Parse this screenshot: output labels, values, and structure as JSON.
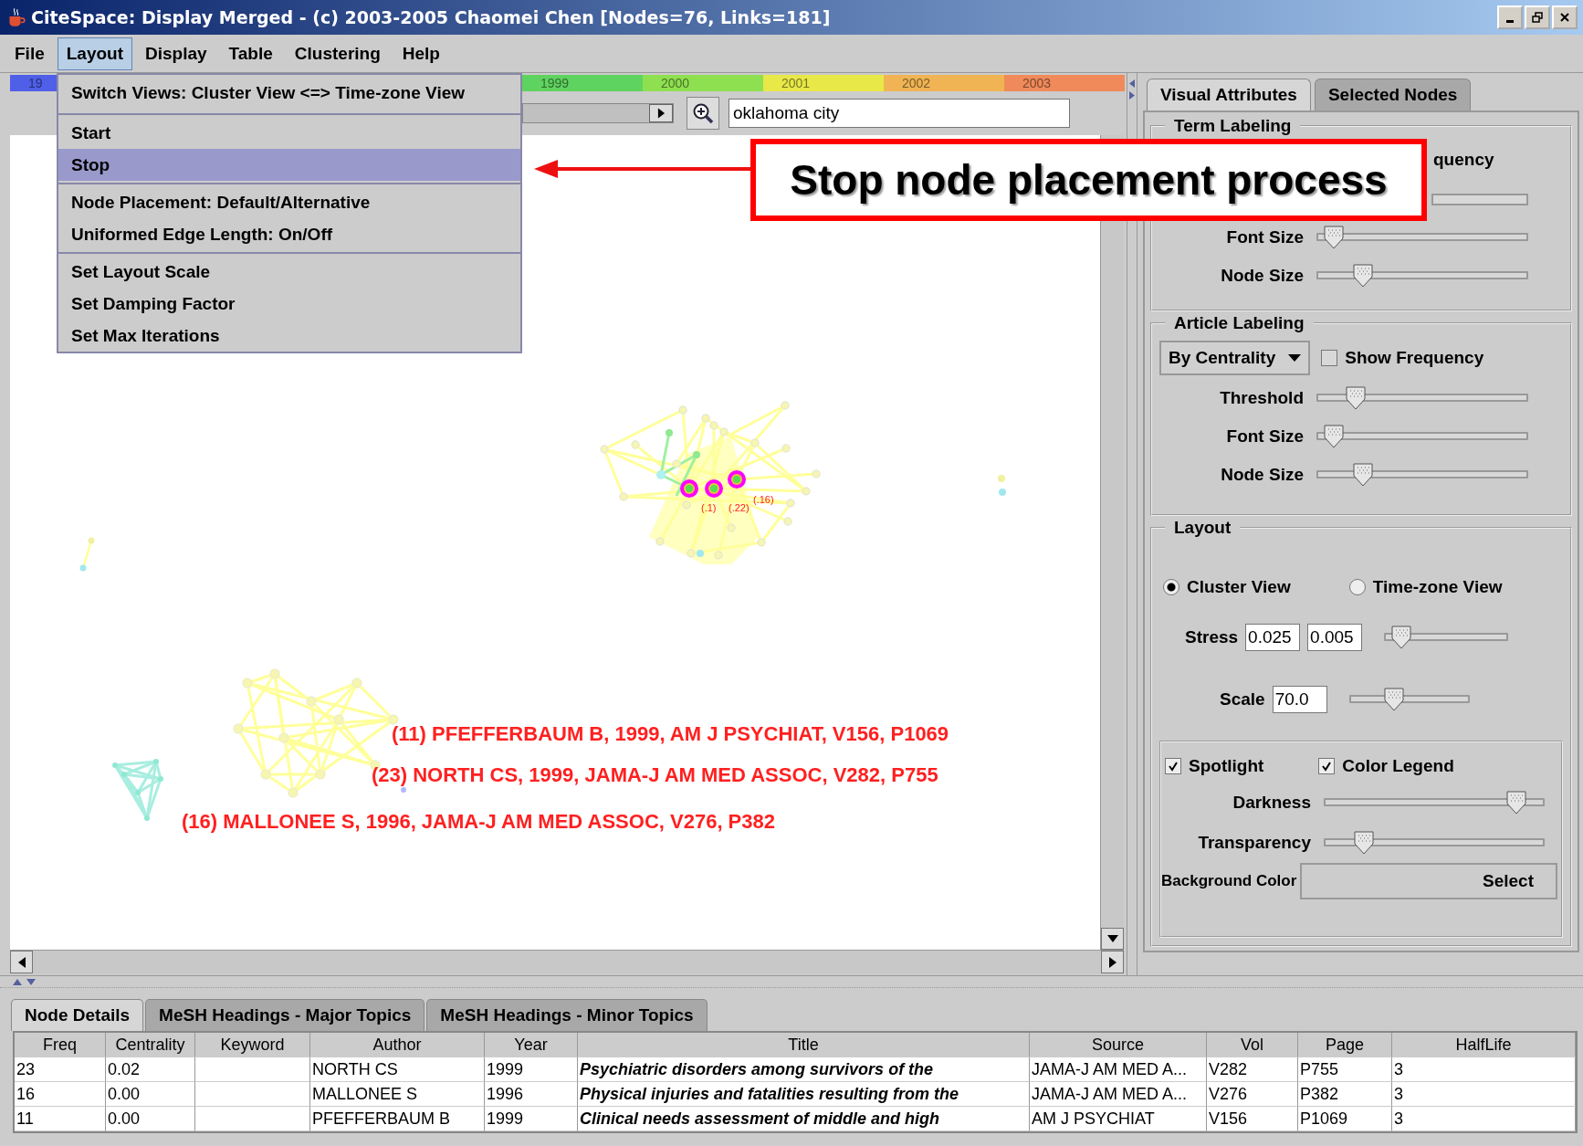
{
  "window": {
    "title": "CiteSpace: Display Merged - (c) 2003-2005 Chaomei Chen [Nodes=76, Links=181]"
  },
  "menu_bar": [
    {
      "label": "File",
      "selected": false
    },
    {
      "label": "Layout",
      "selected": true
    },
    {
      "label": "Display",
      "selected": false
    },
    {
      "label": "Table",
      "selected": false
    },
    {
      "label": "Clustering",
      "selected": false
    },
    {
      "label": "Help",
      "selected": false
    }
  ],
  "layout_menu": {
    "groups": [
      {
        "items": [
          {
            "label": "Switch Views: Cluster View <=> Time-zone View",
            "selected": false
          }
        ]
      },
      {
        "items": [
          {
            "label": "Start",
            "selected": false
          },
          {
            "label": "Stop",
            "selected": true
          }
        ]
      },
      {
        "items": [
          {
            "label": "Node Placement: Default/Alternative",
            "selected": false
          },
          {
            "label": "Uniformed Edge Length: On/Off",
            "selected": false
          }
        ]
      },
      {
        "items": [
          {
            "label": "Set Layout Scale",
            "selected": false
          },
          {
            "label": "Set Damping Factor",
            "selected": false
          },
          {
            "label": "Set Max Iterations",
            "selected": false
          }
        ]
      }
    ]
  },
  "timeline": [
    {
      "label": "19",
      "color": "#4f5fe8"
    },
    {
      "label": "1999",
      "color": "#5fd35f"
    },
    {
      "label": "2000",
      "color": "#8fe050"
    },
    {
      "label": "2001",
      "color": "#e8e848"
    },
    {
      "label": "2002",
      "color": "#f0b454"
    },
    {
      "label": "2003",
      "color": "#f08a5a"
    }
  ],
  "search": {
    "value": "oklahoma city"
  },
  "graph": {
    "labels": [
      {
        "kind": "centrality",
        "text": "(.1)"
      },
      {
        "kind": "centrality",
        "text": "(.22)"
      },
      {
        "kind": "centrality",
        "text": "(.16)"
      },
      {
        "kind": "reference",
        "text": "(11) PFEFFERBAUM B, 1999, AM J PSYCHIAT, V156, P1069"
      },
      {
        "kind": "reference",
        "text": "(23) NORTH CS, 1999, JAMA-J AM MED ASSOC, V282, P755"
      },
      {
        "kind": "reference",
        "text": "(16) MALLONEE S, 1996, JAMA-J AM MED ASSOC, V276, P382"
      }
    ]
  },
  "callout": {
    "text": "Stop node placement process"
  },
  "side_tabs": [
    {
      "label": "Visual Attributes",
      "selected": true
    },
    {
      "label": "Selected Nodes",
      "selected": false
    }
  ],
  "term_labeling": {
    "title": "Term Labeling",
    "partial_text": "quency",
    "sliders": [
      {
        "label": "Font Size",
        "level": 0.04
      },
      {
        "label": "Node Size",
        "level": 0.19
      }
    ]
  },
  "article_labeling": {
    "title": "Article Labeling",
    "dropdown": "By Centrality",
    "show_frequency": {
      "label": "Show Frequency",
      "checked": false
    },
    "sliders": [
      {
        "label": "Threshold",
        "level": 0.15
      },
      {
        "label": "Font Size",
        "level": 0.04
      },
      {
        "label": "Node Size",
        "level": 0.19
      }
    ]
  },
  "layout": {
    "title": "Layout",
    "views": [
      {
        "label": "Cluster View",
        "selected": true
      },
      {
        "label": "Time-zone View",
        "selected": false
      }
    ],
    "stress": {
      "label": "Stress",
      "values": [
        "0.025",
        "0.005"
      ],
      "level": 0.07
    },
    "scale": {
      "label": "Scale",
      "value": "70.0",
      "level": 0.35
    },
    "options": [
      {
        "label": "Spotlight",
        "checked": true
      },
      {
        "label": "Color Legend",
        "checked": true
      }
    ],
    "sliders": [
      {
        "label": "Darkness",
        "level": 0.91
      },
      {
        "label": "Transparency",
        "level": 0.15
      }
    ],
    "background_color": {
      "label": "Background Color",
      "button": "Select"
    }
  },
  "bottom_tabs": [
    {
      "label": "Node Details",
      "selected": true
    },
    {
      "label": "MeSH Headings - Major Topics",
      "selected": false
    },
    {
      "label": "MeSH Headings - Minor Topics",
      "selected": false
    }
  ],
  "table": {
    "columns": [
      "Freq",
      "Centrality",
      "Keyword",
      "Author",
      "Year",
      "Title",
      "Source",
      "Vol",
      "Page",
      "HalfLife"
    ],
    "rows": [
      [
        "23",
        "0.02",
        "",
        "NORTH CS",
        "1999",
        "Psychiatric disorders among survivors of the",
        "JAMA-J AM MED A...",
        "V282",
        "P755",
        "3"
      ],
      [
        "16",
        "0.00",
        "",
        "MALLONEE S",
        "1996",
        "Physical injuries and fatalities resulting from the",
        "JAMA-J AM MED A...",
        "V276",
        "P382",
        "3"
      ],
      [
        "11",
        "0.00",
        "",
        "PFEFFERBAUM B",
        "1999",
        "Clinical needs assessment of middle and high",
        "AM J PSYCHIAT",
        "V156",
        "P1069",
        "3"
      ]
    ]
  }
}
